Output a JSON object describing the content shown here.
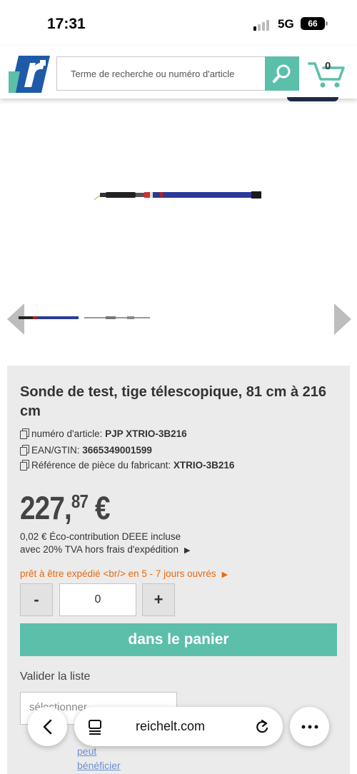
{
  "status": {
    "time": "17:31",
    "network": "5G",
    "battery": "66"
  },
  "header": {
    "search_placeholder": "Terme de recherche ou numéro d'article",
    "cart_count": "0",
    "colors": {
      "accent": "#5bbfaa",
      "logo_blue": "#1e5aa8"
    }
  },
  "product": {
    "title": "Sonde de test, tige télescopique, 81 cm à 216 cm",
    "article_label": "numéro d'article:",
    "article_value": "PJP XTRIO-3B216",
    "ean_label": "EAN/GTIN:",
    "ean_value": "3665349001599",
    "mfr_label": "Référence de pièce du fabricant:",
    "mfr_value": "XTRIO-3B216",
    "price_main": "227,",
    "price_cents": "87",
    "price_currency": "€",
    "eco_line1": "0,02 € Éco-contribution DEEE incluse",
    "eco_line2": "avec 20% TVA hors frais d'expédition",
    "shipping": "prêt à être expédié <br/> en 5 - 7 jours ouvrés",
    "shipping_color": "#e86a10"
  },
  "quantity": {
    "minus_label": "-",
    "value": "0",
    "plus_label": "+"
  },
  "actions": {
    "add_to_cart": "dans le panier",
    "list_label": "Valider la liste",
    "select_placeholder": "sélectionner",
    "peut_line1": "peut",
    "peut_line2": "bénéficier"
  },
  "browser": {
    "url": "reichelt.com"
  }
}
